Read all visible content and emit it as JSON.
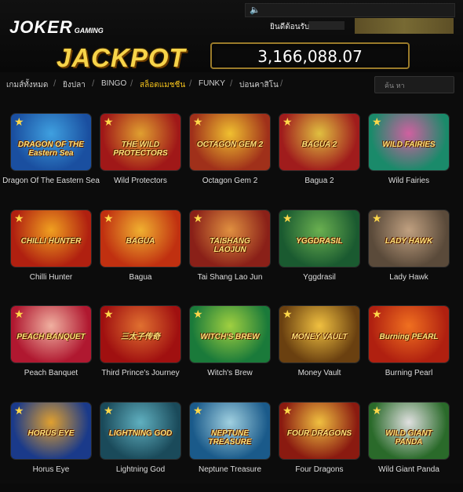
{
  "header": {
    "logo_main": "JOKER",
    "logo_sub": "GAMING",
    "welcome": "ยินดีต้อนรับ",
    "jackpot_label": "JACKPOT",
    "jackpot_value": "3,166,088.07"
  },
  "nav": {
    "items": [
      {
        "label": "เกมส์ทั้งหมด",
        "active": false
      },
      {
        "label": "ยิงปลา",
        "active": false
      },
      {
        "label": "BINGO",
        "active": false
      },
      {
        "label": "สล็อตแมชชีน",
        "active": true
      },
      {
        "label": "FUNKY",
        "active": false
      },
      {
        "label": "บ่อนคาสิโน",
        "active": false
      }
    ],
    "search_placeholder": "ค้น หา"
  },
  "games": [
    {
      "name": "Dragon Of The Eastern Sea",
      "art": "DRAGON OF THE Eastern Sea",
      "colors": [
        "#1a4fa0",
        "#3fa0e0"
      ]
    },
    {
      "name": "Wild Protectors",
      "art": "THE WILD PROTECTORS",
      "colors": [
        "#a01818",
        "#e0a030"
      ]
    },
    {
      "name": "Octagon Gem 2",
      "art": "OCTAGON GEM 2",
      "colors": [
        "#a0301a",
        "#f0c030"
      ]
    },
    {
      "name": "Bagua 2",
      "art": "BAGUA 2",
      "colors": [
        "#a01c1c",
        "#e0c040"
      ]
    },
    {
      "name": "Wild Fairies",
      "art": "WILD FAIRIES",
      "colors": [
        "#1a8a6a",
        "#d060a0"
      ]
    },
    {
      "name": "Chilli Hunter",
      "art": "CHILLI HUNTER",
      "colors": [
        "#b02010",
        "#f0a020"
      ]
    },
    {
      "name": "Bagua",
      "art": "BAGUA",
      "colors": [
        "#c03010",
        "#f0b030"
      ]
    },
    {
      "name": "Tai Shang Lao Jun",
      "art": "TAISHANG LAOJUN",
      "colors": [
        "#8a2018",
        "#e09040"
      ]
    },
    {
      "name": "Yggdrasil",
      "art": "YGGDRASIL",
      "colors": [
        "#1a5a30",
        "#6ab050"
      ]
    },
    {
      "name": "Lady Hawk",
      "art": "LADY HAWK",
      "colors": [
        "#5a4a3a",
        "#c0a080"
      ]
    },
    {
      "name": "Peach Banquet",
      "art": "PEACH BANQUET",
      "colors": [
        "#b01830",
        "#f0b0a0"
      ]
    },
    {
      "name": "Third Prince's Journey",
      "art": "三太子传奇",
      "colors": [
        "#a01010",
        "#e07030"
      ]
    },
    {
      "name": "Witch's Brew",
      "art": "WITCH'S BREW",
      "colors": [
        "#1a7a3a",
        "#a0d040"
      ]
    },
    {
      "name": "Money Vault",
      "art": "MONEY VAULT",
      "colors": [
        "#6a4010",
        "#f0c040"
      ]
    },
    {
      "name": "Burning Pearl",
      "art": "Burning PEARL",
      "colors": [
        "#b02010",
        "#f07020"
      ]
    },
    {
      "name": "Horus Eye",
      "art": "HORUS EYE",
      "colors": [
        "#1a3a8a",
        "#e0a030"
      ]
    },
    {
      "name": "Lightning God",
      "art": "LIGHTNING GOD",
      "colors": [
        "#1a4a5a",
        "#60b0c0"
      ]
    },
    {
      "name": "Neptune Treasure",
      "art": "NEPTUNE TREASURE",
      "colors": [
        "#1a5a8a",
        "#a0d0e0"
      ]
    },
    {
      "name": "Four Dragons",
      "art": "FOUR DRAGONS",
      "colors": [
        "#8a1a10",
        "#f0c040"
      ]
    },
    {
      "name": "Wild Giant Panda",
      "art": "WILD GIANT PANDA",
      "colors": [
        "#2a6a2a",
        "#e0e0e0"
      ]
    }
  ]
}
